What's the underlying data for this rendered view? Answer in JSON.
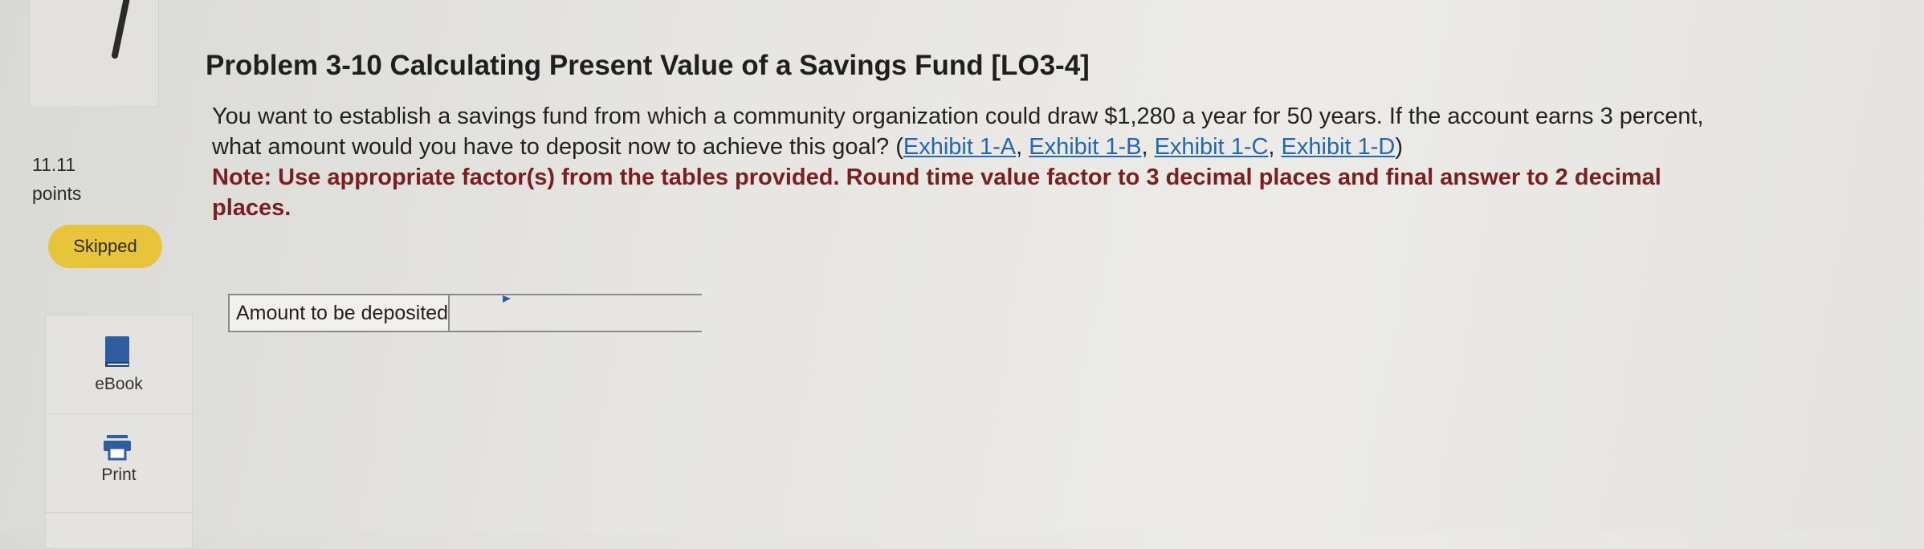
{
  "question": {
    "number_glyph": "slash-number-icon",
    "points_value": "11.11",
    "points_label": "points",
    "status_badge": "Skipped"
  },
  "tools": {
    "ebook_label": "eBook",
    "ebook_icon": "book-icon",
    "print_label": "Print",
    "print_icon": "printer-icon"
  },
  "problem": {
    "title": "Problem 3-10 Calculating Present Value of a Savings Fund [LO3-4]",
    "body_text": "You want to establish a savings fund from which a community organization could draw $1,280 a year for 50 years. If the account earns 3 percent, what amount would you have to deposit now to achieve this goal? (",
    "exhibits": [
      "Exhibit 1-A",
      "Exhibit 1-B",
      "Exhibit 1-C",
      "Exhibit 1-D"
    ],
    "separator": ", ",
    "close_paren": ")",
    "note": "Note: Use appropriate factor(s) from the tables provided. Round time value factor to 3 decimal places and final answer to 2 decimal places."
  },
  "answer": {
    "label": "Amount to be deposited",
    "value": ""
  },
  "colors": {
    "badge": "#e7c43a",
    "link": "#2367b3",
    "note": "#7a1f1f",
    "icon": "#2f5ea0"
  }
}
